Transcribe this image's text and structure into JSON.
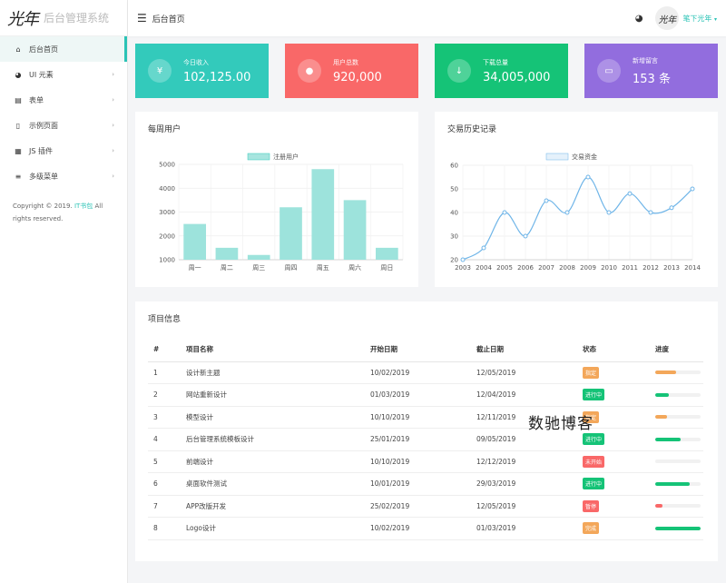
{
  "brand": {
    "logo": "光年",
    "name": "后台管理系统"
  },
  "sidebar": {
    "items": [
      {
        "label": "后台首页",
        "icon": "home-icon",
        "glyph": "⌂",
        "arrow": ""
      },
      {
        "label": "UI 元素",
        "icon": "palette-icon",
        "glyph": "◕",
        "arrow": "›"
      },
      {
        "label": "表单",
        "icon": "form-icon",
        "glyph": "▤",
        "arrow": "›"
      },
      {
        "label": "示例页面",
        "icon": "file-icon",
        "glyph": "▯",
        "arrow": "›"
      },
      {
        "label": "JS 插件",
        "icon": "js-icon",
        "glyph": "▦",
        "arrow": "›"
      },
      {
        "label": "多级菜单",
        "icon": "menu-icon",
        "glyph": "≡",
        "arrow": "›"
      }
    ],
    "copyright": {
      "pre": "Copyright © 2019.",
      "link": "IT书包",
      "post": "All rights reserved."
    }
  },
  "topbar": {
    "title": "后台首页",
    "menu_glyph": "☰",
    "palette_glyph": "◕",
    "avatar": "光年",
    "user": "笔下光年",
    "caret": "▾"
  },
  "stats": [
    {
      "label": "今日收入",
      "value": "102,125.00",
      "glyph": "¥",
      "color": "#33cabb",
      "icon": "yen-icon"
    },
    {
      "label": "用户总数",
      "value": "920,000",
      "glyph": "●",
      "color": "#f96868",
      "icon": "user-icon"
    },
    {
      "label": "下载总量",
      "value": "34,005,000",
      "glyph": "↓",
      "color": "#15c377",
      "icon": "download-icon"
    },
    {
      "label": "新增留言",
      "value": "153 条",
      "glyph": "▭",
      "color": "#926dde",
      "icon": "comment-icon"
    }
  ],
  "weekly_title": "每周用户",
  "trade_title": "交易历史记录",
  "chart_data": [
    {
      "type": "bar",
      "title": "每周用户",
      "legend": "注册用户",
      "color": "#33cabb",
      "categories": [
        "周一",
        "周二",
        "周三",
        "周四",
        "周五",
        "周六",
        "周日"
      ],
      "series": [
        {
          "name": "注册用户",
          "values": [
            2500,
            1500,
            1200,
            3200,
            4800,
            3500,
            1500
          ]
        }
      ],
      "yticks": [
        1000,
        2000,
        3000,
        4000,
        5000
      ],
      "ylim": [
        1000,
        5000
      ]
    },
    {
      "type": "line",
      "title": "交易历史记录",
      "legend": "交易资金",
      "color": "#6fb5e8",
      "categories": [
        "2003",
        "2004",
        "2005",
        "2006",
        "2007",
        "2008",
        "2009",
        "2010",
        "2011",
        "2012",
        "2013",
        "2014"
      ],
      "series": [
        {
          "name": "交易资金",
          "values": [
            20,
            25,
            40,
            30,
            45,
            40,
            55,
            40,
            48,
            40,
            42,
            50
          ]
        }
      ],
      "yticks": [
        20,
        30,
        40,
        50,
        60
      ],
      "ylim": [
        20,
        60
      ]
    }
  ],
  "project": {
    "title": "项目信息",
    "headers": [
      "#",
      "项目名称",
      "开始日期",
      "截止日期",
      "状态",
      "进度"
    ],
    "rows": [
      {
        "no": "1",
        "name": "设计新主题",
        "start": "10/02/2019",
        "end": "12/05/2019",
        "status": "指定",
        "scolor": "#f3a75a",
        "progress": 0.45,
        "pcolor": "#f3a75a"
      },
      {
        "no": "2",
        "name": "网站重新设计",
        "start": "01/03/2019",
        "end": "12/04/2019",
        "status": "进行中",
        "scolor": "#15c377",
        "progress": 0.3,
        "pcolor": "#15c377"
      },
      {
        "no": "3",
        "name": "模型设计",
        "start": "10/10/2019",
        "end": "12/11/2019",
        "status": "指定",
        "scolor": "#f3a75a",
        "progress": 0.25,
        "pcolor": "#f3a75a"
      },
      {
        "no": "4",
        "name": "后台管理系统模板设计",
        "start": "25/01/2019",
        "end": "09/05/2019",
        "status": "进行中",
        "scolor": "#15c377",
        "progress": 0.55,
        "pcolor": "#15c377"
      },
      {
        "no": "5",
        "name": "前端设计",
        "start": "10/10/2019",
        "end": "12/12/2019",
        "status": "未开始",
        "scolor": "#f96868",
        "progress": 0.0,
        "pcolor": "#f96868"
      },
      {
        "no": "6",
        "name": "桌面软件测试",
        "start": "10/01/2019",
        "end": "29/03/2019",
        "status": "进行中",
        "scolor": "#15c377",
        "progress": 0.75,
        "pcolor": "#15c377"
      },
      {
        "no": "7",
        "name": "APP改版开发",
        "start": "25/02/2019",
        "end": "12/05/2019",
        "status": "暂停",
        "scolor": "#f96868",
        "progress": 0.15,
        "pcolor": "#f96868"
      },
      {
        "no": "8",
        "name": "Logo设计",
        "start": "10/02/2019",
        "end": "01/03/2019",
        "status": "完成",
        "scolor": "#f3a75a",
        "progress": 1.0,
        "pcolor": "#15c377"
      }
    ]
  },
  "watermark": "数驰博客"
}
